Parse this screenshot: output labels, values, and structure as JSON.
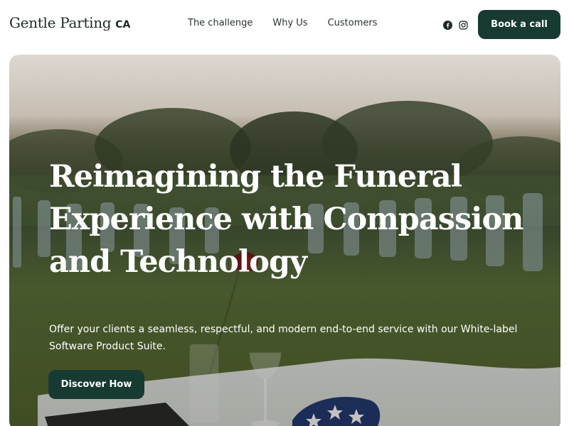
{
  "header": {
    "brand": {
      "name": "Gentle Parting",
      "suffix": "CA"
    },
    "nav": [
      {
        "label": "The challenge"
      },
      {
        "label": "Why Us"
      },
      {
        "label": "Customers"
      }
    ],
    "social": [
      {
        "icon": "facebook-icon"
      },
      {
        "icon": "instagram-icon"
      }
    ],
    "cta_label": "Book a call"
  },
  "hero": {
    "title": "Reimagining the Funeral Experience with Compassion and Technology",
    "subtitle": "Offer your clients a seamless, respectful, and modern end-to-end service with our White-label Software Product Suite.",
    "button_label": "Discover How",
    "background": "cemetery-photo"
  },
  "colors": {
    "accent": "#173a33",
    "text_light": "#ffffff",
    "text_dark": "#1d2a2a"
  }
}
